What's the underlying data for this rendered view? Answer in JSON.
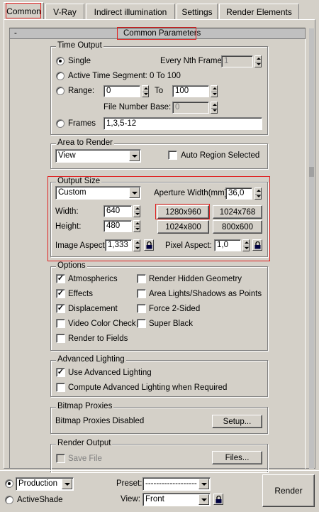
{
  "tabs": [
    {
      "label": "Common"
    },
    {
      "label": "V-Ray"
    },
    {
      "label": "Indirect illumination"
    },
    {
      "label": "Settings"
    },
    {
      "label": "Render Elements"
    }
  ],
  "rollout": {
    "collapse": "-",
    "title": "Common Parameters"
  },
  "time_output": {
    "title": "Time Output",
    "single": "Single",
    "every_nth_label": "Every Nth Frame:",
    "every_nth_value": "1",
    "active_segment": "Active Time Segment:",
    "active_segment_value": "0 To 100",
    "range": "Range:",
    "range_from": "0",
    "range_to_label": "To",
    "range_to": "100",
    "file_number_base_label": "File Number Base:",
    "file_number_base_value": "0",
    "frames": "Frames",
    "frames_value": "1,3,5-12"
  },
  "area_to_render": {
    "title": "Area to Render",
    "dropdown": "View",
    "auto_region": "Auto Region Selected"
  },
  "output_size": {
    "title": "Output Size",
    "preset": "Custom",
    "aperture_label": "Aperture Width(mm):",
    "aperture_value": "36,0",
    "width_label": "Width:",
    "width_value": "640",
    "height_label": "Height:",
    "height_value": "480",
    "presets": [
      "1280x960",
      "1024x768",
      "1024x800",
      "800x600"
    ],
    "image_aspect_label": "Image Aspect:",
    "image_aspect_value": "1,333",
    "pixel_aspect_label": "Pixel Aspect:",
    "pixel_aspect_value": "1,0"
  },
  "options": {
    "title": "Options",
    "atmospherics": "Atmospherics",
    "render_hidden": "Render Hidden Geometry",
    "effects": "Effects",
    "area_lights": "Area Lights/Shadows as Points",
    "displacement": "Displacement",
    "force_2sided": "Force 2-Sided",
    "video_color": "Video Color Check",
    "super_black": "Super Black",
    "render_fields": "Render to Fields",
    "check_mark": "✓"
  },
  "advanced_lighting": {
    "title": "Advanced Lighting",
    "use": "Use Advanced Lighting",
    "compute": "Compute Advanced Lighting when Required"
  },
  "bitmap_proxies": {
    "title": "Bitmap Proxies",
    "status": "Bitmap Proxies Disabled",
    "setup": "Setup..."
  },
  "render_output": {
    "title": "Render Output",
    "save_file": "Save File",
    "files": "Files..."
  },
  "bottom": {
    "production": "Production",
    "activeshade": "ActiveShade",
    "preset_label": "Preset:",
    "preset_value": "-------------------",
    "view_label": "View:",
    "view_value": "Front",
    "render": "Render"
  }
}
